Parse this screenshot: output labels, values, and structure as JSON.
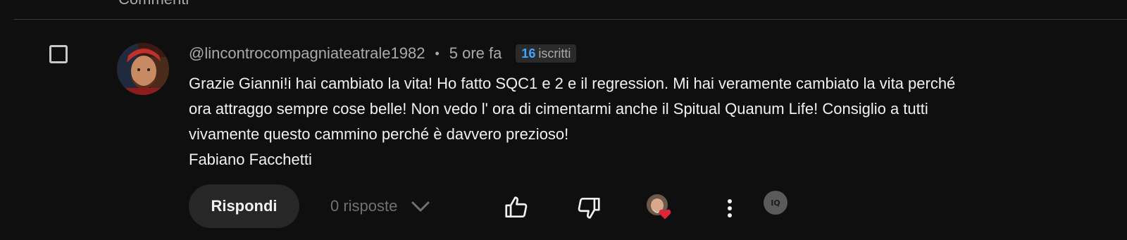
{
  "header": {
    "label": "Commenti"
  },
  "comment": {
    "username": "@lincontrocompagniateatrale1982",
    "separator": "•",
    "time": "5 ore fa",
    "subscribers_count": "16",
    "subscribers_label": "iscritti",
    "body_lines": [
      "Grazie Gianni!i hai cambiato la vita! Ho fatto SQC1 e 2 e il regression. Mi hai veramente cambiato la vita perché",
      "ora attraggo sempre cose belle! Non vedo l' ora di cimentarmi anche il Spitual Quanum Life!  Consiglio a tutti",
      "vivamente questo cammino perché è davvero prezioso!",
      "Fabiano Facchetti"
    ]
  },
  "actions": {
    "reply_label": "Rispondi",
    "replies_label": "0 risposte",
    "extension_label": "IQ"
  },
  "colors": {
    "background": "#0f0f0f",
    "text_primary": "#f1f1f1",
    "text_secondary": "#aaaaaa",
    "accent_blue": "#3ea6ff",
    "heart_red": "#e0243a",
    "button_bg": "#272727"
  },
  "icons": {
    "checkbox": "checkbox-icon",
    "like": "thumbs-up-icon",
    "dislike": "thumbs-down-icon",
    "creator_heart": "creator-heart-icon",
    "more": "more-vertical-icon",
    "replies_toggle": "chevron-down-icon",
    "extension": "iq-extension-icon"
  }
}
